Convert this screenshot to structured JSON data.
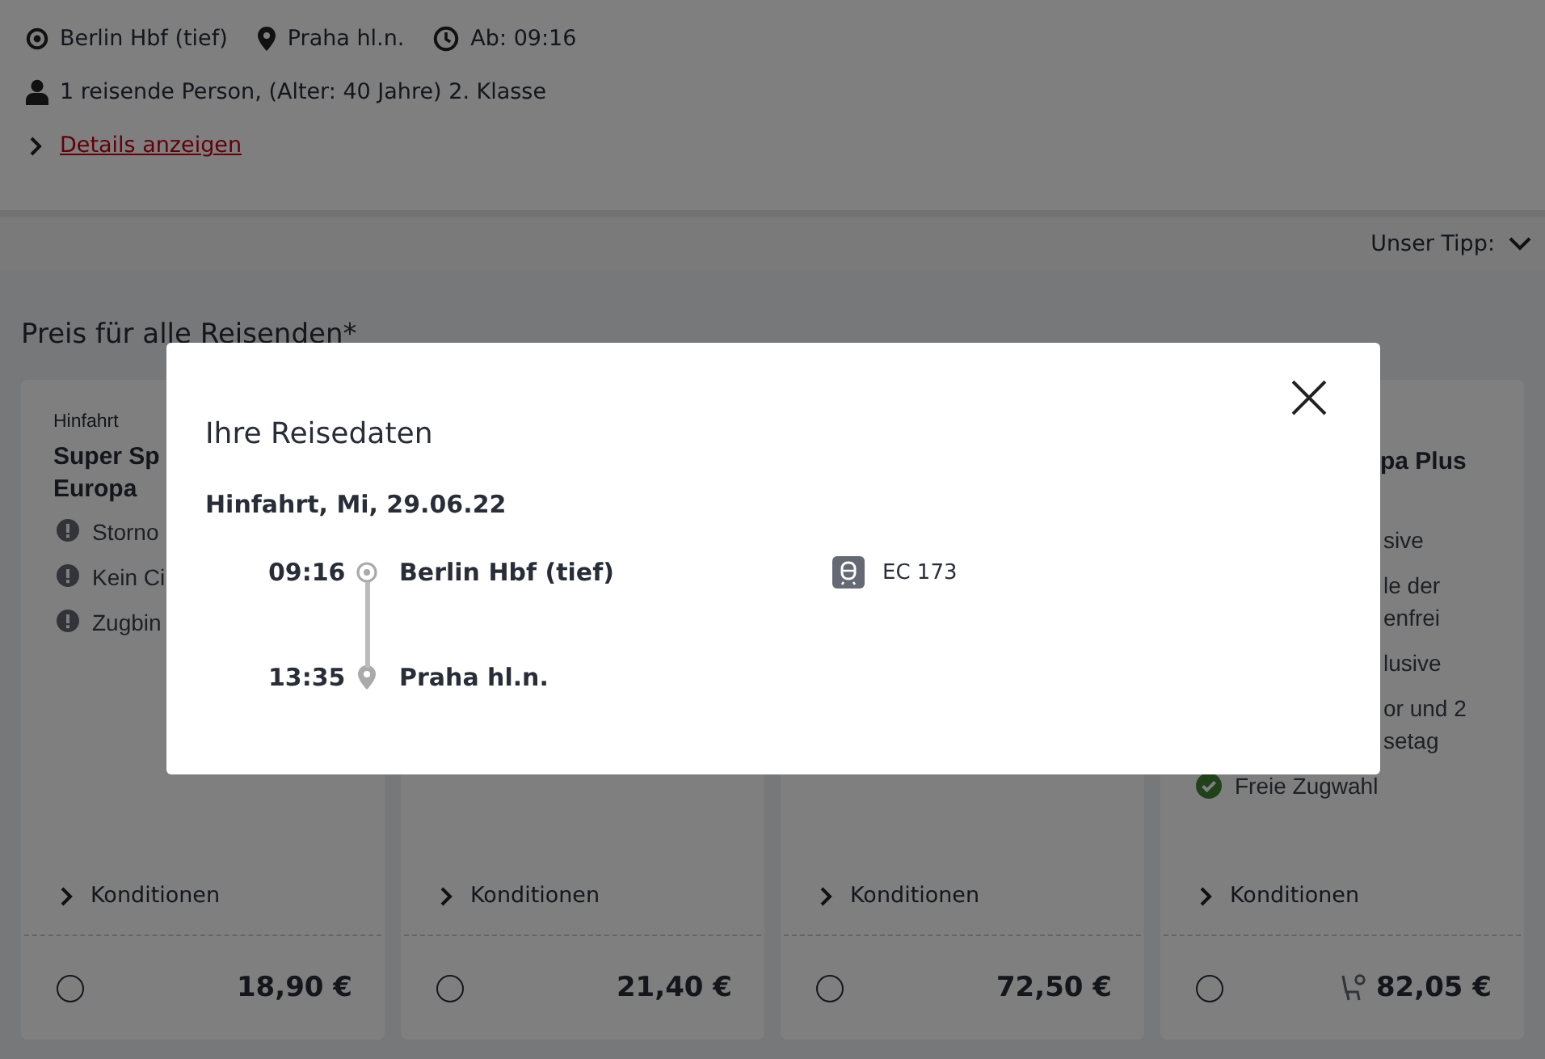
{
  "header": {
    "from": "Berlin Hbf (tief)",
    "to": "Praha hl.n.",
    "departure": "Ab: 09:16",
    "passengers": "1 reisende Person, (Alter: 40 Jahre) 2. Klasse",
    "details_link": "Details anzeigen"
  },
  "sort": {
    "label": "Unser Tipp:"
  },
  "price_heading": "Preis für alle Reisenden*",
  "cards": [
    {
      "label": "Hinfahrt",
      "title": "Super Sp\nEuropa",
      "title_cut": false,
      "features": [
        {
          "kind": "warning",
          "text": "Storno"
        },
        {
          "kind": "warning",
          "text": "Kein Ci"
        },
        {
          "kind": "warning",
          "text": "Zugbin"
        }
      ],
      "conditions": "Konditionen",
      "selected": false,
      "seat_reservation": false,
      "price": "18,90 €"
    },
    {
      "conditions": "Konditionen",
      "selected": false,
      "seat_reservation": false,
      "price": "21,40 €"
    },
    {
      "conditions": "Konditionen",
      "selected": false,
      "seat_reservation": false,
      "price": "72,50 €"
    },
    {
      "title": "pa Plus",
      "title_cut": true,
      "features": [
        {
          "kind": "cut",
          "text": "sive"
        },
        {
          "kind": "cut",
          "text": "le der\nenfrei"
        },
        {
          "kind": "cut",
          "text": "lusive"
        },
        {
          "kind": "cut",
          "text": "or und 2\nsetag"
        },
        {
          "kind": "check",
          "text": "Freie Zugwahl"
        }
      ],
      "conditions": "Konditionen",
      "selected": false,
      "seat_reservation": true,
      "price": "82,05 €"
    }
  ],
  "modal": {
    "title": "Ihre Reisedaten",
    "direction": "Hinfahrt, Mi, 29.06.22",
    "stops": [
      {
        "kind": "origin",
        "time": "09:16",
        "station": "Berlin Hbf (tief)"
      },
      {
        "kind": "destination",
        "time": "13:35",
        "station": "Praha hl.n."
      }
    ],
    "train": "EC 173"
  }
}
